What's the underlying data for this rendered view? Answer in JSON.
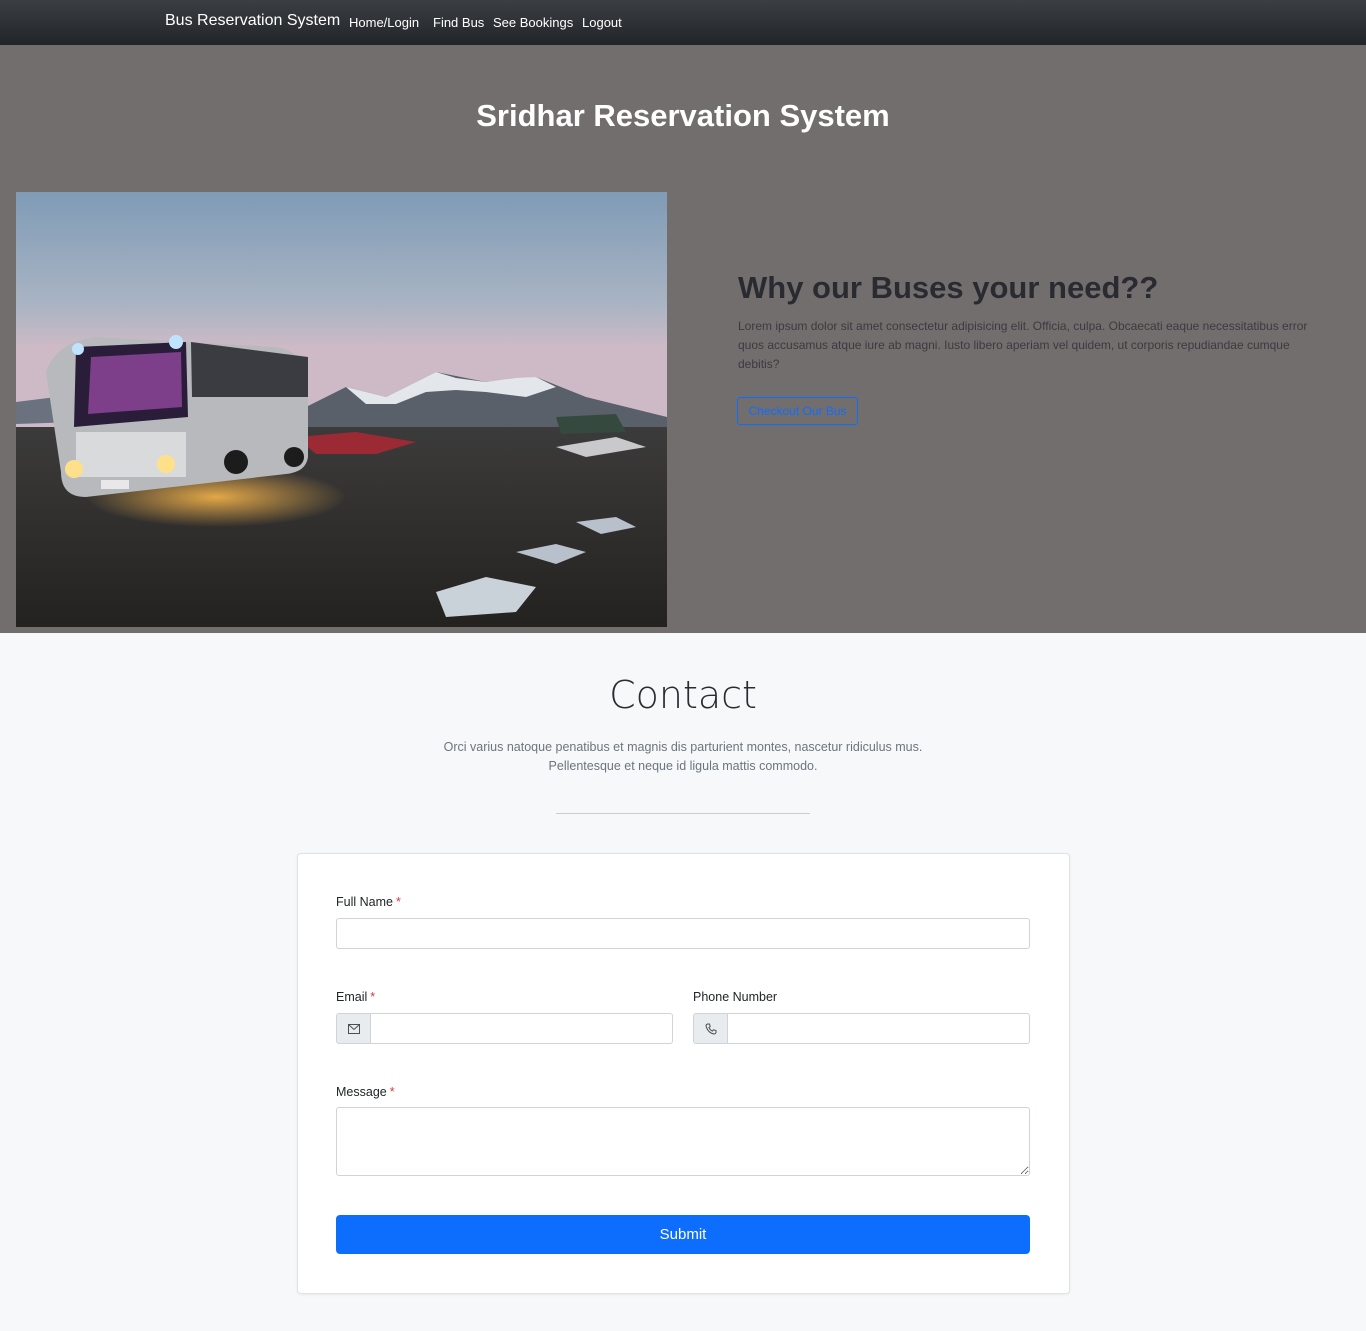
{
  "navbar": {
    "brand": "Bus Reservation System",
    "links": [
      "Home/Login",
      "Find Bus",
      "See Bookings",
      "Logout"
    ]
  },
  "hero": {
    "title": "Sridhar Reservation System",
    "image_icon": "bus-photo",
    "why_title": "Why our Buses your need??",
    "why_text": "Lorem ipsum dolor sit amet consectetur adipisicing elit. Officia, culpa. Obcaecati eaque necessitatibus error quos accusamus atque iure ab magni. Iusto libero aperiam vel quidem, ut corporis repudiandae cumque debitis?",
    "checkout_label": "Checkout Our Bus"
  },
  "contact": {
    "title": "Contact",
    "subtitle_line1": "Orci varius natoque penatibus et magnis dis parturient montes, nascetur ridiculus mus.",
    "subtitle_line2": "Pellentesque et neque id ligula mattis commodo.",
    "form": {
      "full_name_label": "Full Name",
      "email_label": "Email",
      "phone_label": "Phone Number",
      "message_label": "Message",
      "required_mark": "*",
      "full_name_value": "",
      "email_value": "",
      "phone_value": "",
      "message_value": "",
      "email_icon": "envelope-icon",
      "phone_icon": "phone-icon",
      "submit_label": "Submit"
    }
  },
  "colors": {
    "navbar": "#212529",
    "hero_bg": "#736e6e",
    "accent": "#0d6efd",
    "required": "#dc3545",
    "page_bg": "#f7f8fa"
  }
}
